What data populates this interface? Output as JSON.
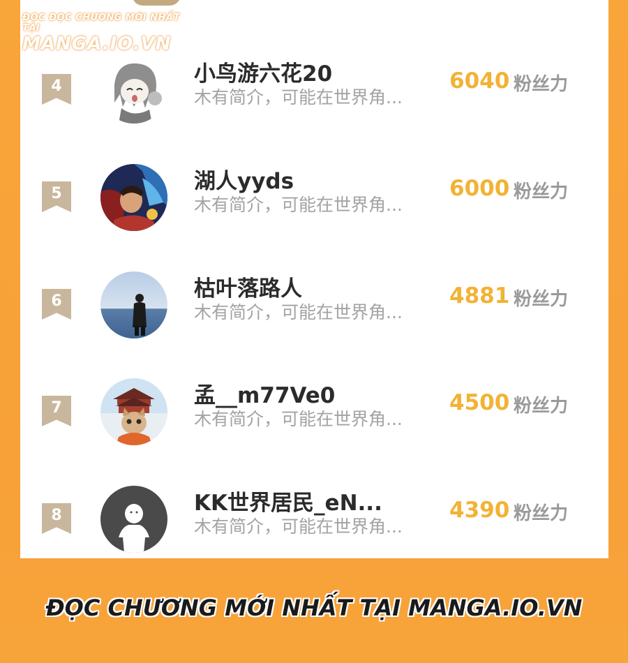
{
  "watermark": {
    "line1": "ĐỌC ĐỌC CHƯƠNG MỚI NHẤT TẠI",
    "line2": "MANGA.IO.VN"
  },
  "ranking": {
    "items": [
      {
        "rank": "4",
        "name": "小鸟游六花20",
        "bio": "木有简介，可能在世界角...",
        "score": "6040",
        "unit": "粉丝力",
        "avatar": "anime-girl-avatar"
      },
      {
        "rank": "5",
        "name": "湖人yyds",
        "bio": "木有简介，可能在世界角...",
        "score": "6000",
        "unit": "粉丝力",
        "avatar": "anime-art-avatar"
      },
      {
        "rank": "6",
        "name": "枯叶落路人",
        "bio": "木有简介，可能在世界角...",
        "score": "4881",
        "unit": "粉丝力",
        "avatar": "person-by-water-avatar"
      },
      {
        "rank": "7",
        "name": "孟__m77Ve0",
        "bio": "木有简介，可能在世界角...",
        "score": "4500",
        "unit": "粉丝力",
        "avatar": "cat-palace-avatar"
      },
      {
        "rank": "8",
        "name": "KK世界居民_eN...",
        "bio": "木有简介，可能在世界角...",
        "score": "4390",
        "unit": "粉丝力",
        "avatar": "default-avatar"
      }
    ]
  },
  "footer": {
    "banner": "ĐỌC CHƯƠNG MỚI NHẤT TẠI MANGA.IO.VN"
  },
  "colors": {
    "background": "#f8a53a",
    "rank_badge": "#c8b79c",
    "score": "#f2b234",
    "name": "#2b2b2b",
    "bio": "#a3a3a3",
    "unit": "#9a9a9a"
  }
}
